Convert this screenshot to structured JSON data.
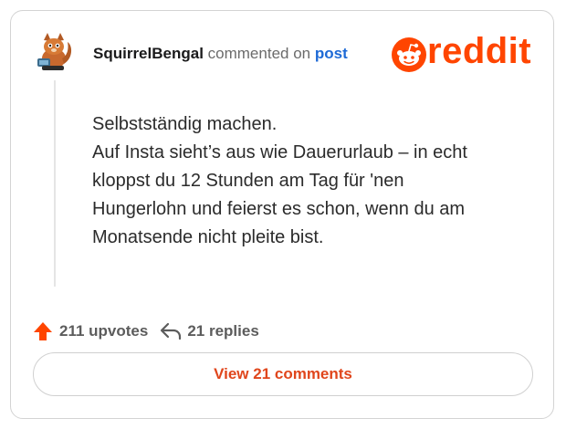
{
  "comment": {
    "username": "SquirrelBengal",
    "action_text": "commented on",
    "post_link_label": "post",
    "lines": [
      "Selbstständig machen.",
      "Auf Insta sieht’s aus wie Dauerurlaub – in echt",
      "kloppst du 12 Stunden am Tag für 'nen",
      "Hungerlohn und feierst es schon, wenn du am",
      "Monatsende nicht pleite bist."
    ]
  },
  "brand": {
    "wordmark": "reddit",
    "color": "#ff4500"
  },
  "stats": {
    "upvotes_label": "211 upvotes",
    "replies_label": "21 replies",
    "upvote_icon": "upvote-arrow-icon",
    "reply_icon": "reply-arrow-icon"
  },
  "cta": {
    "label": "View 21 comments",
    "color": "#e0461c"
  }
}
